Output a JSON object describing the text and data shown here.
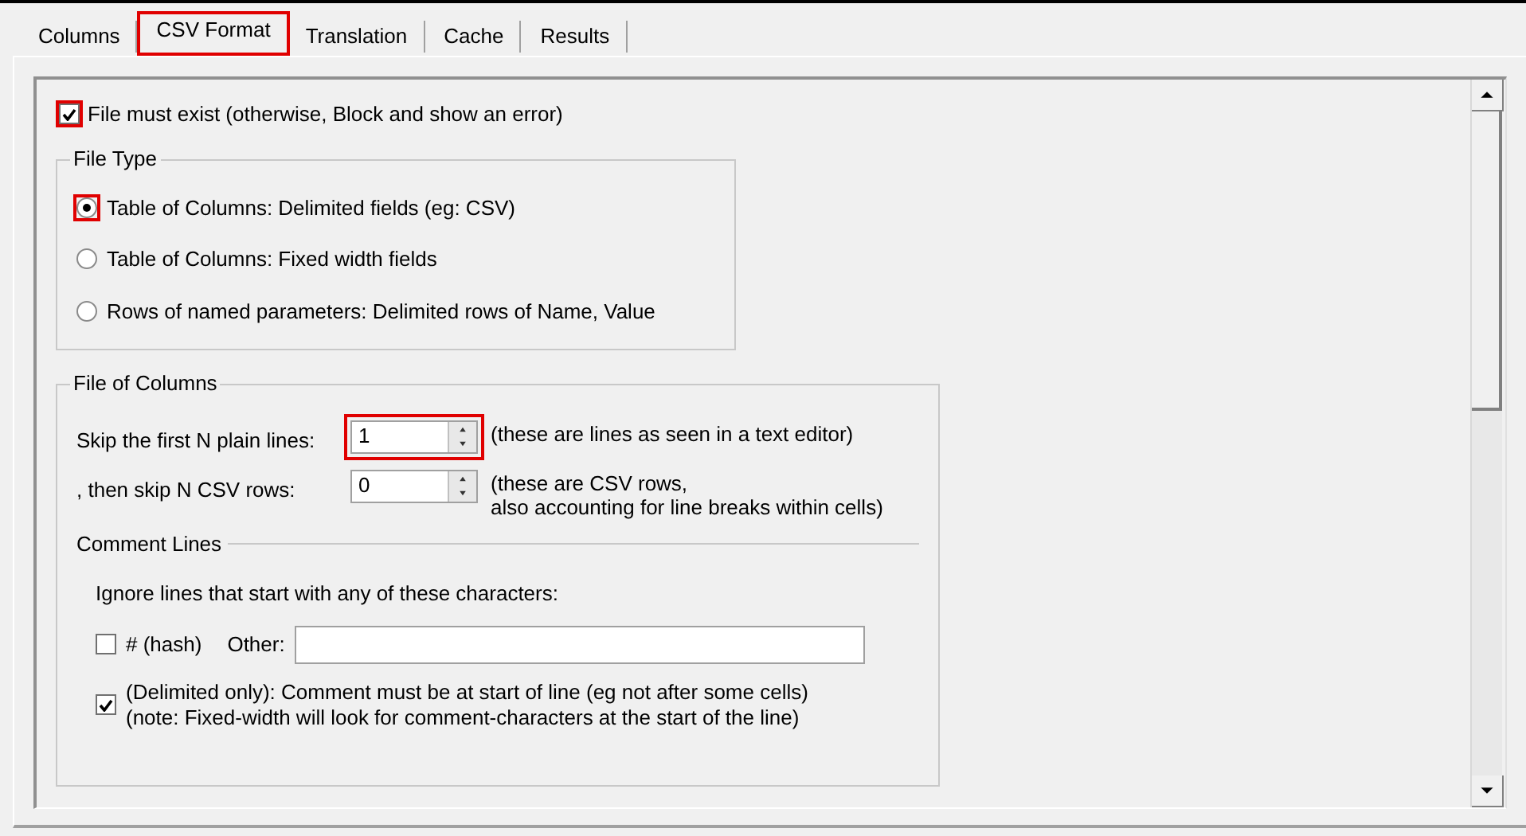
{
  "tabs": [
    {
      "label": "Columns",
      "selected": false,
      "highlighted": false
    },
    {
      "label": "CSV Format",
      "selected": true,
      "highlighted": true
    },
    {
      "label": "Translation",
      "selected": false,
      "highlighted": false
    },
    {
      "label": "Cache",
      "selected": false,
      "highlighted": false
    },
    {
      "label": "Results",
      "selected": false,
      "highlighted": false
    }
  ],
  "file_must_exist": {
    "label": "File must exist (otherwise, Block and show an error)",
    "checked": true,
    "highlighted": true
  },
  "file_type": {
    "title": "File Type",
    "options": [
      {
        "label": "Table of Columns: Delimited fields (eg: CSV)",
        "selected": true,
        "highlighted": true
      },
      {
        "label": "Table of Columns: Fixed width fields",
        "selected": false,
        "highlighted": false
      },
      {
        "label": "Rows of named parameters: Delimited rows of Name, Value",
        "selected": false,
        "highlighted": false
      }
    ]
  },
  "file_of_columns": {
    "title": "File of Columns",
    "spinners": [
      {
        "label": "Skip the first N plain lines:",
        "value": "1",
        "note": "(these are lines as seen in a text editor)",
        "highlighted": true
      },
      {
        "label": ", then skip N CSV rows:",
        "value": "0",
        "note": "(these are CSV rows,\nalso accounting for line breaks within cells)",
        "highlighted": false
      }
    ],
    "comment_lines": {
      "title": "Comment Lines",
      "intro": "Ignore lines that start with any of these characters:",
      "hash": {
        "label": "# (hash)",
        "checked": false
      },
      "other": {
        "label": "Other:"
      },
      "start_of_line": {
        "label": "(Delimited only): Comment must be at start of line (eg not after some cells)\n(note: Fixed-width will look for comment-characters at the start of the line)",
        "checked": true
      }
    }
  }
}
